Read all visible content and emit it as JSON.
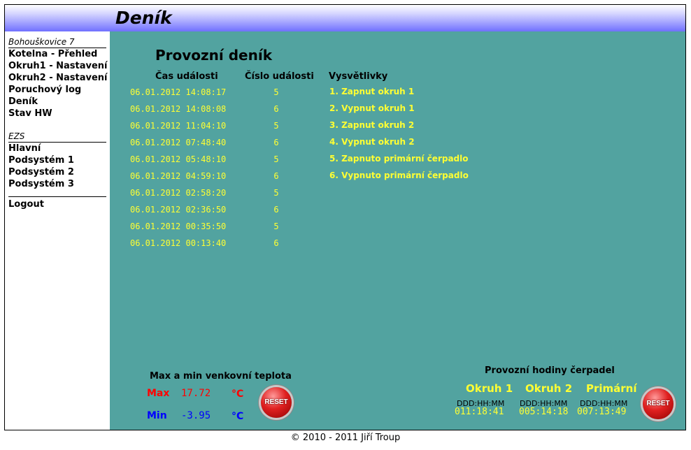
{
  "header": {
    "title": "Deník"
  },
  "sidebar": {
    "section1_title": "Bohouškovice 7",
    "section1_items": [
      "Kotelna - Přehled",
      "Okruh1 - Nastavení",
      "Okruh2 - Nastavení",
      "Poruchový log",
      "Deník",
      "Stav HW"
    ],
    "section2_title": "EZS",
    "section2_items": [
      "Hlavní",
      "Podsystém 1",
      "Podsystém 2",
      "Podsystém 3"
    ],
    "logout": "Logout"
  },
  "journal": {
    "title": "Provozní deník",
    "col_time": "Čas události",
    "col_event": "Číslo události",
    "col_legend": "Vysvětlivky",
    "rows": [
      {
        "time": "06.01.2012 14:08:17",
        "num": "5"
      },
      {
        "time": "06.01.2012 14:08:08",
        "num": "6"
      },
      {
        "time": "06.01.2012 11:04:10",
        "num": "5"
      },
      {
        "time": "06.01.2012 07:48:40",
        "num": "6"
      },
      {
        "time": "06.01.2012 05:48:10",
        "num": "5"
      },
      {
        "time": "06.01.2012 04:59:10",
        "num": "6"
      },
      {
        "time": "06.01.2012 02:58:20",
        "num": "5"
      },
      {
        "time": "06.01.2012 02:36:50",
        "num": "6"
      },
      {
        "time": "06.01.2012 00:35:50",
        "num": "5"
      },
      {
        "time": "06.01.2012 00:13:40",
        "num": "6"
      }
    ],
    "legend": [
      "1. Zapnut okruh 1",
      "2. Vypnut okruh 1",
      "3. Zapnut okruh 2",
      "4. Vypnut okruh 2",
      "5. Zapnuto primární čerpadlo",
      "6. Vypnuto primární čerpadlo"
    ]
  },
  "temperature": {
    "title": "Max a min venkovní teplota",
    "max_label": "Max",
    "max_value": "17.72",
    "min_label": "Min",
    "min_value": "-3.95",
    "unit": "°C",
    "reset_label": "RESET"
  },
  "pump_hours": {
    "title": "Provozní hodiny čerpadel",
    "format": "DDD:HH:MM",
    "columns": [
      {
        "name": "Okruh 1",
        "value": "011:18:41"
      },
      {
        "name": "Okruh 2",
        "value": "005:14:18"
      },
      {
        "name": "Primární",
        "value": "007:13:49"
      }
    ],
    "reset_label": "RESET"
  },
  "footer": "© 2010 - 2011 Jiří Troup",
  "colors": {
    "main_bg": "#52a3a0",
    "highlight": "#ffff33",
    "max": "#ff0000",
    "min": "#0000ff"
  }
}
